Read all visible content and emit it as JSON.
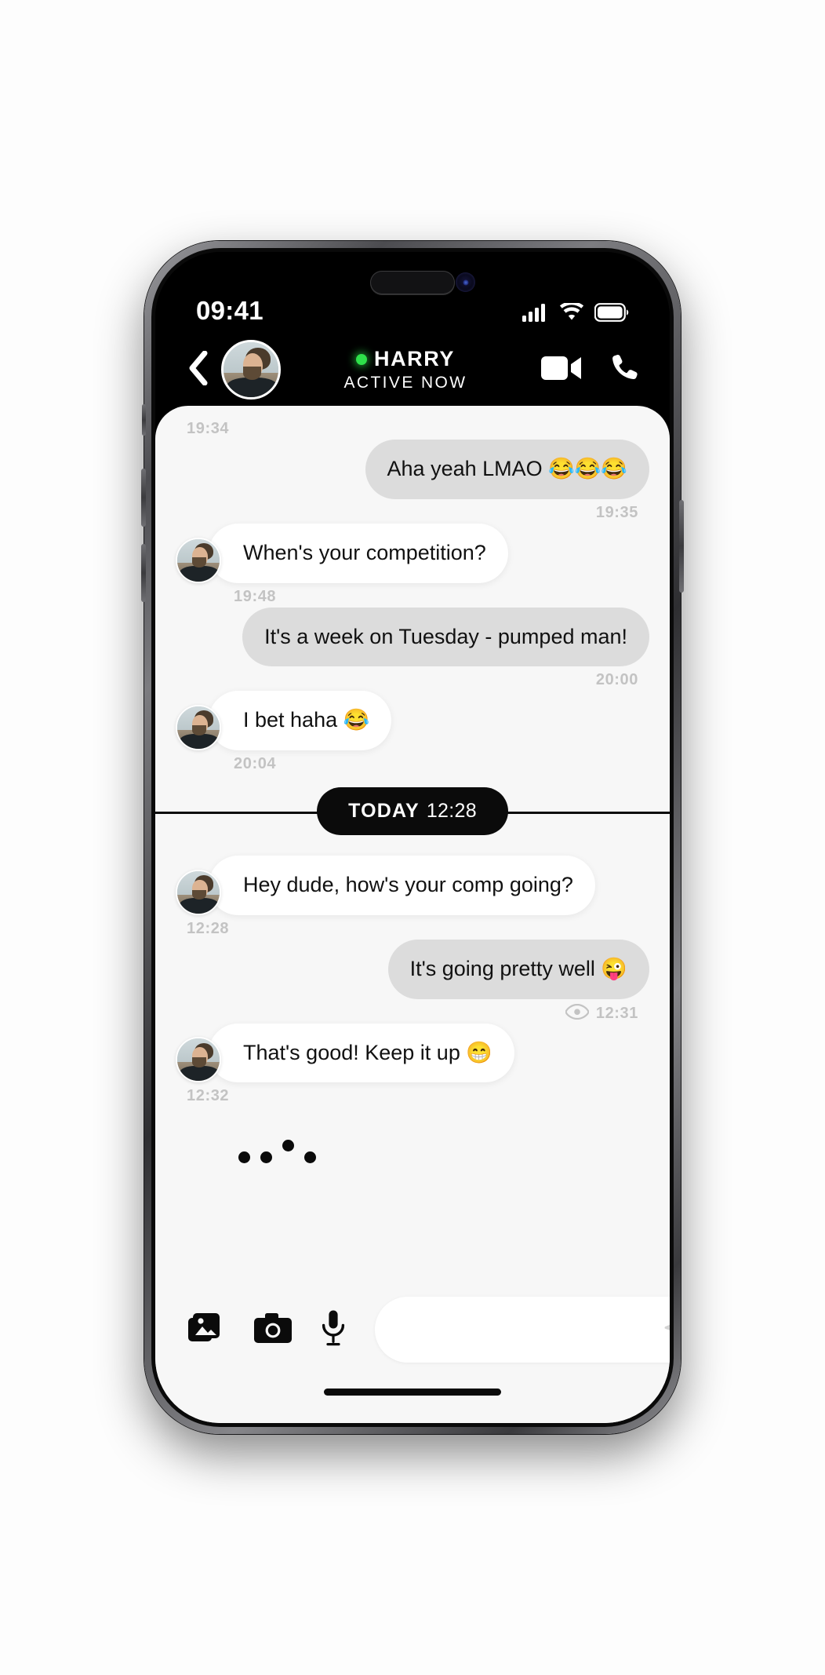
{
  "status_bar": {
    "time": "09:41",
    "cellular_icon": "cellular-signal-icon",
    "wifi_icon": "wifi-icon",
    "battery_icon": "battery-full-icon"
  },
  "header": {
    "back_icon": "chevron-left-icon",
    "avatar": "contact-avatar",
    "name": "HARRY",
    "presence": "ACTIVE NOW",
    "presence_dot_color": "#2ee04a",
    "video_call_icon": "video-camera-icon",
    "voice_call_icon": "phone-icon"
  },
  "conversation": {
    "items": [
      {
        "kind": "timestamp",
        "align": "left",
        "text": "19:34"
      },
      {
        "kind": "message",
        "direction": "out",
        "text": "Aha yeah LMAO 😂😂😂"
      },
      {
        "kind": "timestamp",
        "align": "right",
        "text": "19:35"
      },
      {
        "kind": "message",
        "direction": "in",
        "text": "When's your competition?"
      },
      {
        "kind": "timestamp",
        "align": "left",
        "text": "19:48"
      },
      {
        "kind": "message",
        "direction": "out",
        "text": "It's a week on Tuesday - pumped man!"
      },
      {
        "kind": "timestamp",
        "align": "right",
        "text": "20:00"
      },
      {
        "kind": "message",
        "direction": "in",
        "text": "I bet haha 😂"
      },
      {
        "kind": "timestamp",
        "align": "left",
        "text": "20:04"
      },
      {
        "kind": "divider",
        "label": "TODAY",
        "time": "12:28"
      },
      {
        "kind": "message",
        "direction": "in",
        "text": "Hey dude, how's your comp going?"
      },
      {
        "kind": "timestamp",
        "align": "left",
        "text": "12:28"
      },
      {
        "kind": "message",
        "direction": "out",
        "text": "It's going pretty well 😜"
      },
      {
        "kind": "timestamp",
        "align": "right",
        "text": "12:31",
        "read_icon": "eye-seen-icon"
      },
      {
        "kind": "message",
        "direction": "in",
        "text": "That's good! Keep it up 😁"
      },
      {
        "kind": "timestamp",
        "align": "left",
        "text": "12:32"
      },
      {
        "kind": "typing"
      }
    ]
  },
  "composer": {
    "gallery_icon": "photo-library-icon",
    "camera_icon": "camera-icon",
    "mic_icon": "microphone-icon",
    "input_value": "",
    "input_placeholder": "",
    "send_icon": "send-paper-plane-icon"
  },
  "colors": {
    "header_bg": "#000000",
    "chat_bg": "#f7f7f7",
    "bubble_out": "#dcdcdc",
    "bubble_in": "#ffffff",
    "timestamp": "#c3c3c3",
    "divider": "#0b0b0b"
  }
}
